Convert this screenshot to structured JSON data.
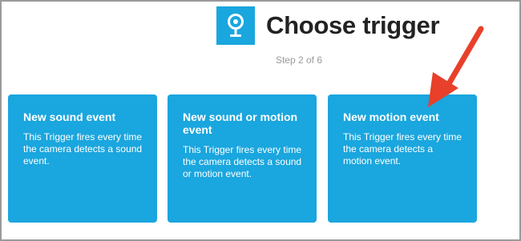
{
  "header": {
    "title": "Choose trigger",
    "step": "Step 2 of 6",
    "service_icon": "camera-icon"
  },
  "cards": [
    {
      "title": "New sound event",
      "description": "This Trigger fires every time the camera detects a sound event."
    },
    {
      "title": "New sound or motion event",
      "description": "This Trigger fires every time the camera detects a sound or motion event."
    },
    {
      "title": "New motion event",
      "description": "This Trigger fires every time the camera detects a motion event."
    }
  ],
  "annotation": {
    "arrow_color": "#e8402a",
    "arrow_target": "New motion event"
  },
  "colors": {
    "card": "#1aa6de",
    "title": "#222222",
    "step": "#9a9a9a"
  }
}
